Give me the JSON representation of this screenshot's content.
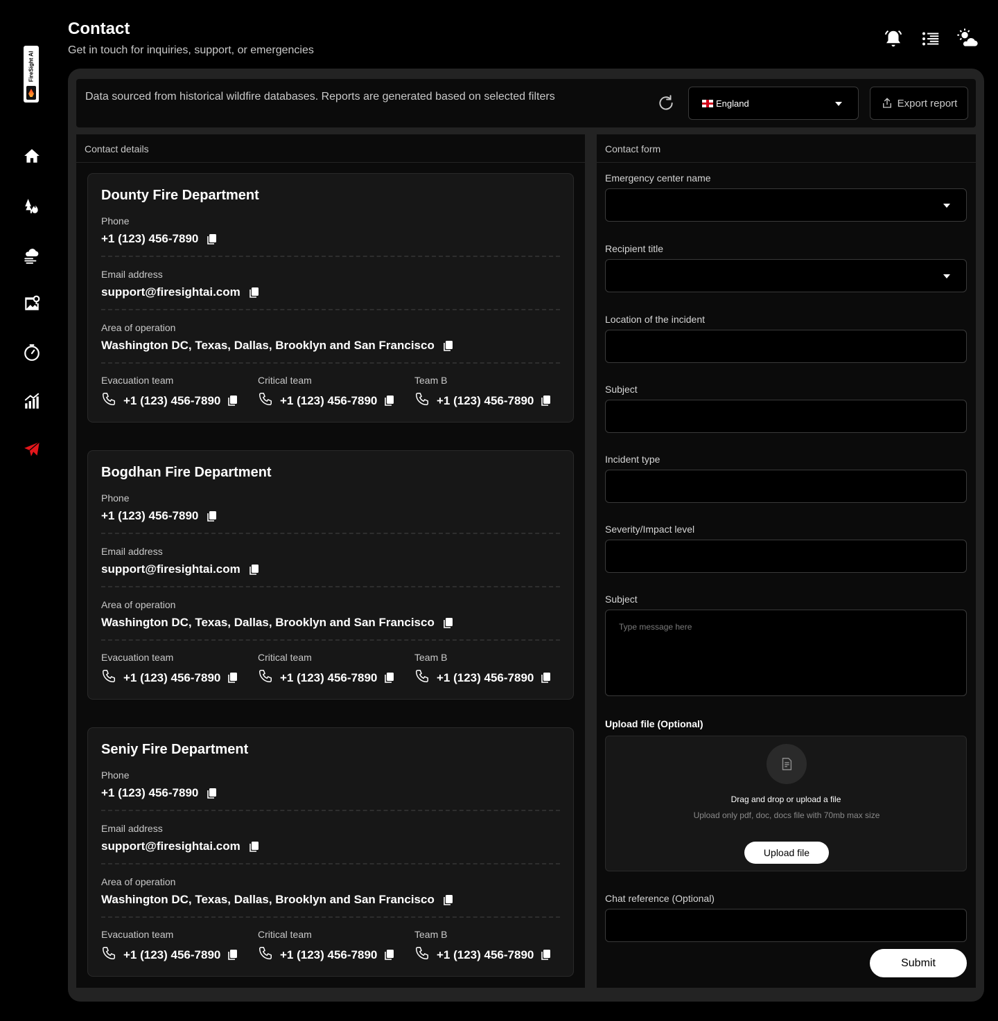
{
  "header": {
    "title": "Contact",
    "subtitle": "Get in touch for inquiries, support, or emergencies"
  },
  "brand": {
    "logo_text": "FireSight AI"
  },
  "sidebar": {
    "items": [
      {
        "icon": "home-icon"
      },
      {
        "icon": "fire-trees-icon"
      },
      {
        "icon": "weather-wind-icon"
      },
      {
        "icon": "map-pin-icon"
      },
      {
        "icon": "clock-icon"
      },
      {
        "icon": "analytics-icon"
      },
      {
        "icon": "send-icon",
        "active": true
      }
    ],
    "active_color": "#e3161b"
  },
  "topbar": {
    "note": "Data sourced from historical wildfire databases. Reports are generated based on selected filters",
    "country": "England",
    "export_label": "Export report"
  },
  "contact_details": {
    "title": "Contact details",
    "departments": [
      {
        "name": "Dounty Fire Department",
        "phone_label": "Phone",
        "phone": "+1 (123) 456-7890",
        "email_label": "Email address",
        "email": "support@firesightai.com",
        "area_label": "Area of operation",
        "area": "Washington DC, Texas, Dallas, Brooklyn and San Francisco",
        "teams": [
          {
            "label": "Evacuation team",
            "phone": "+1 (123) 456-7890"
          },
          {
            "label": "Critical team",
            "phone": "+1 (123) 456-7890"
          },
          {
            "label": "Team B",
            "phone": "+1 (123) 456-7890"
          }
        ]
      },
      {
        "name": "Bogdhan Fire Department",
        "phone_label": "Phone",
        "phone": "+1 (123) 456-7890",
        "email_label": "Email address",
        "email": "support@firesightai.com",
        "area_label": "Area of operation",
        "area": "Washington DC, Texas, Dallas, Brooklyn and San Francisco",
        "teams": [
          {
            "label": "Evacuation team",
            "phone": "+1 (123) 456-7890"
          },
          {
            "label": "Critical team",
            "phone": "+1 (123) 456-7890"
          },
          {
            "label": "Team B",
            "phone": "+1 (123) 456-7890"
          }
        ]
      },
      {
        "name": "Seniy Fire Department",
        "phone_label": "Phone",
        "phone": "+1 (123) 456-7890",
        "email_label": "Email address",
        "email": "support@firesightai.com",
        "area_label": "Area of operation",
        "area": "Washington DC, Texas, Dallas, Brooklyn and San Francisco",
        "teams": [
          {
            "label": "Evacuation team",
            "phone": "+1 (123) 456-7890"
          },
          {
            "label": "Critical team",
            "phone": "+1 (123) 456-7890"
          },
          {
            "label": "Team B",
            "phone": "+1 (123) 456-7890"
          }
        ]
      }
    ]
  },
  "contact_form": {
    "title": "Contact form",
    "fields": {
      "center_name": "Emergency center name",
      "recipient_title": "Recipient title",
      "location": "Location of the incident",
      "subject": "Subject",
      "incident_type": "Incident type",
      "severity": "Severity/Impact level",
      "message_label": "Subject",
      "message_placeholder": "Type message here",
      "upload_label": "Upload file (Optional)",
      "chat_reference": "Chat reference (Optional)"
    },
    "upload": {
      "title": "Drag and drop or upload a file",
      "hint": "Upload only pdf, doc, docs file with 70mb max size",
      "button": "Upload file"
    },
    "submit": "Submit"
  }
}
